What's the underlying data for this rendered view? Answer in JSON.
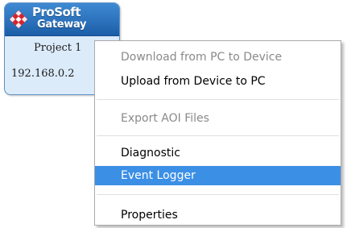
{
  "device": {
    "logo_line1": "ProSoft",
    "logo_line2": "Gateway",
    "project_name": "Project 1",
    "ip_address": "192.168.0.2",
    "brand_color": "#d5262e"
  },
  "context_menu": {
    "items": [
      {
        "label": "Download from PC to Device",
        "enabled": false
      },
      {
        "label": "Upload from Device to PC",
        "enabled": true
      },
      {
        "label": "Export AOI Files",
        "enabled": false
      },
      {
        "label": "Diagnostic",
        "enabled": true
      },
      {
        "label": "Event Logger",
        "enabled": true,
        "highlighted": true
      },
      {
        "label": "Properties",
        "enabled": true
      }
    ],
    "highlight_color": "#3b8fe5"
  }
}
